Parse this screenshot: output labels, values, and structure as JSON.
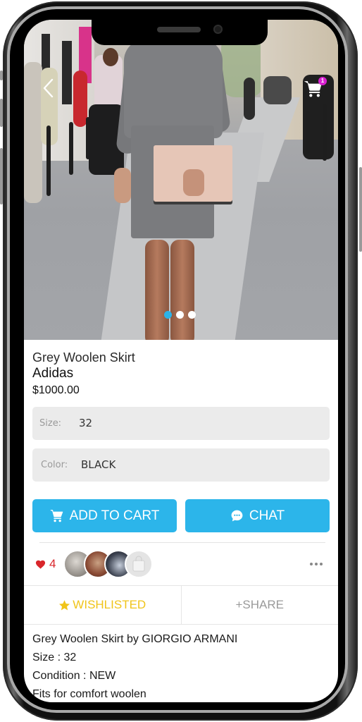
{
  "product": {
    "name": "Grey Woolen Skirt",
    "brand": "Adidas",
    "price": "$1000.00"
  },
  "header": {
    "back_icon": "chevron-left-icon",
    "cart_icon": "shopping-cart-icon",
    "cart_badge": "1"
  },
  "carousel": {
    "total": 3,
    "active_index": 0
  },
  "options": {
    "size": {
      "label": "Size:",
      "value": "32"
    },
    "color": {
      "label": "Color:",
      "value": "BLACK"
    }
  },
  "buttons": {
    "add_to_cart": "ADD TO CART",
    "chat": "CHAT"
  },
  "social": {
    "likes_count": "4",
    "avatars": [
      "store-avatar-1",
      "store-avatar-2",
      "store-avatar-3",
      "shop-placeholder-avatar"
    ],
    "shop_placeholder_text": "Shop"
  },
  "actions": {
    "wishlist": "WISHLISTED",
    "share": "+SHARE"
  },
  "description": {
    "lines": [
      "Grey Woolen Skirt by GIORGIO ARMANI",
      "Size :  32",
      "Condition : NEW",
      "Fits for comfort woolen"
    ]
  },
  "colors": {
    "accent_blue": "#2cb5ea",
    "wishlist_yellow": "#f0c419",
    "like_red": "#d9262b",
    "badge_magenta": "#d81fd0",
    "field_bg": "#ebebeb"
  }
}
